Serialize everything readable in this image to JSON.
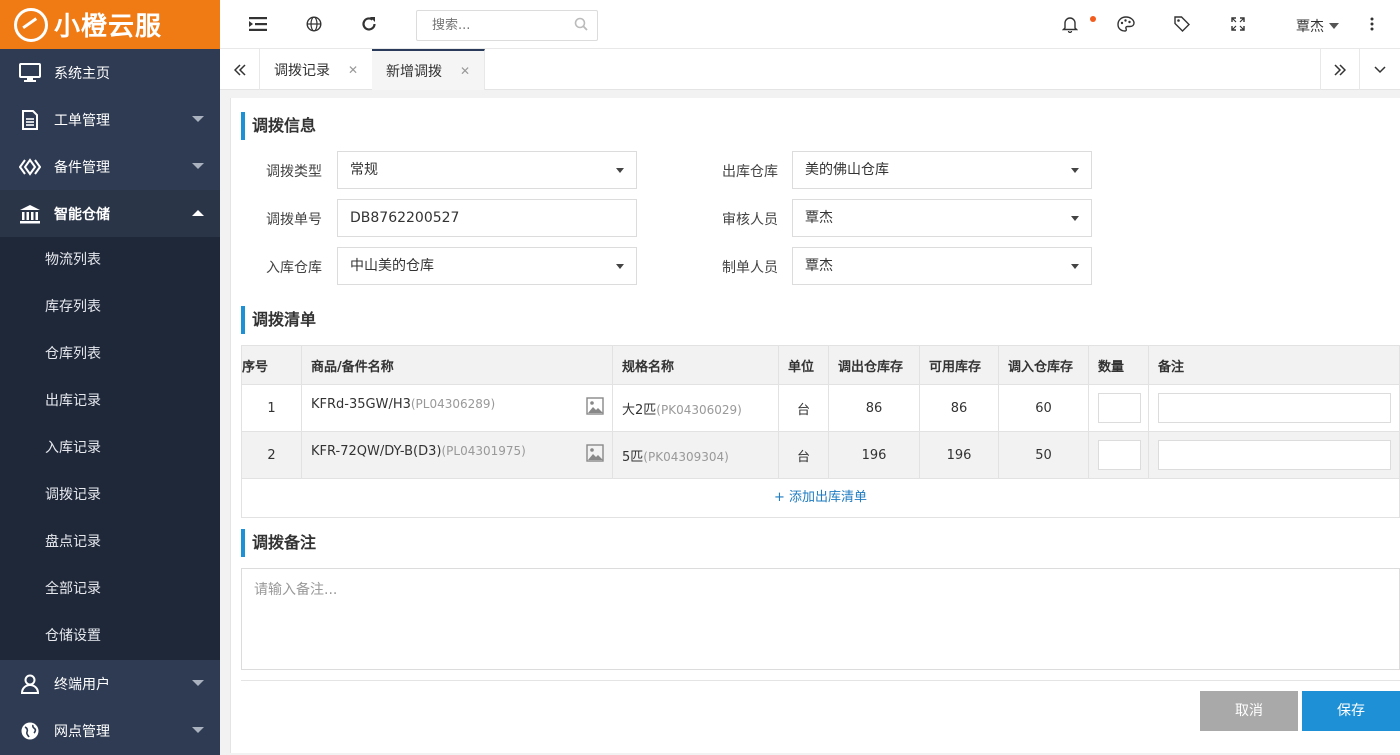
{
  "brand": {
    "name": "小橙云服",
    "color": "#f07a14"
  },
  "sidebar": {
    "items": [
      {
        "label": "系统主页",
        "icon": "monitor-icon"
      },
      {
        "label": "工单管理",
        "icon": "document-icon"
      },
      {
        "label": "备件管理",
        "icon": "parts-icon"
      },
      {
        "label": "智能仓储",
        "icon": "warehouse-icon"
      },
      {
        "label": "终端用户",
        "icon": "user-icon"
      },
      {
        "label": "网点管理",
        "icon": "globe-icon"
      }
    ],
    "submenu": [
      "物流列表",
      "库存列表",
      "仓库列表",
      "出库记录",
      "入库记录",
      "调拨记录",
      "盘点记录",
      "全部记录",
      "仓储设置"
    ]
  },
  "header": {
    "search_placeholder": "搜索...",
    "user": "覃杰"
  },
  "tabs": [
    {
      "label": "调拨记录",
      "active": false
    },
    {
      "label": "新增调拨",
      "active": true
    }
  ],
  "form": {
    "section_info": "调拨信息",
    "type_label": "调拨类型",
    "type_value": "常规",
    "no_label": "调拨单号",
    "no_value": "DB8762200527",
    "in_label": "入库仓库",
    "in_value": "中山美的仓库",
    "out_label": "出库仓库",
    "out_value": "美的佛山仓库",
    "auditor_label": "审核人员",
    "auditor_value": "覃杰",
    "maker_label": "制单人员",
    "maker_value": "覃杰"
  },
  "list": {
    "section_title": "调拨清单",
    "headers": [
      "序号",
      "商品/备件名称",
      "规格名称",
      "单位",
      "调出仓库存",
      "可用库存",
      "调入仓库存",
      "数量",
      "备注"
    ],
    "rows": [
      {
        "no": "1",
        "name": "KFRd-35GW/H3",
        "code": "(PL04306289)",
        "spec": "大2匹",
        "spec_code": "(PK04306029)",
        "unit": "台",
        "out_stock": "86",
        "available": "86",
        "in_stock": "60"
      },
      {
        "no": "2",
        "name": "KFR-72QW/DY-B(D3)",
        "code": "(PL04301975)",
        "spec": "5匹",
        "spec_code": "(PK04309304)",
        "unit": "台",
        "out_stock": "196",
        "available": "196",
        "in_stock": "50"
      }
    ],
    "add_label": "+ 添加出库清单"
  },
  "remark": {
    "section_title": "调拨备注",
    "placeholder": "请输入备注..."
  },
  "actions": {
    "cancel": "取消",
    "save": "保存"
  },
  "colors": {
    "accent": "#1e90d6",
    "sidebar": "#2f3b52",
    "submenu": "#1f2839",
    "cancel": "#a9a9a9"
  }
}
